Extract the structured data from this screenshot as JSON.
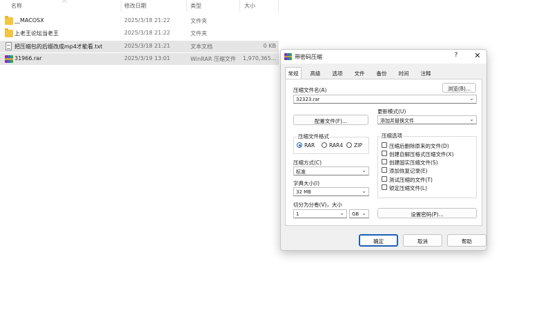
{
  "explorer": {
    "columns": {
      "name": "名称",
      "date": "修改日期",
      "type": "类型",
      "size": "大小"
    },
    "rows": [
      {
        "name": "__MACOSX",
        "date": "2025/3/18 21:22",
        "type": "文件夹",
        "size": "",
        "icon": "folder-icon"
      },
      {
        "name": "上老王论坛当老王",
        "date": "2025/3/18 21:22",
        "type": "文件夹",
        "size": "",
        "icon": "folder-icon"
      },
      {
        "name": "把压缩包的后缀改成mp4才能看.txt",
        "date": "2025/3/18 21:21",
        "type": "文本文档",
        "size": "0 KB",
        "icon": "text-file-icon"
      },
      {
        "name": "31966.rar",
        "date": "2025/3/19 13:01",
        "type": "WinRAR 压缩文件",
        "size": "1,970,365...",
        "icon": "rar-archive-icon"
      }
    ]
  },
  "dialog": {
    "title": "带密码压缩",
    "help": "?",
    "close": "✕",
    "tabs": [
      "常规",
      "高级",
      "选项",
      "文件",
      "备份",
      "时间",
      "注释"
    ],
    "archive_name_label": "压缩文件名(A)",
    "archive_name_value": "32323.rar",
    "browse_label": "浏览(B)...",
    "profiles_label": "配置文件(F)...",
    "update_mode_label": "更新模式(U)",
    "update_mode_value": "添加并替换文件",
    "format_group_label": "压缩文件格式",
    "formats": [
      "RAR",
      "RAR4",
      "ZIP"
    ],
    "selected_format": "RAR",
    "method_label": "压缩方式(C)",
    "method_value": "标准",
    "dict_label": "字典大小(I)",
    "dict_value": "32 MB",
    "split_label": "切分为分卷(V)，大小",
    "split_value": "1",
    "split_unit": "GB",
    "options_group_label": "压缩选项",
    "options": [
      "压缩后删除原来的文件(D)",
      "创建自解压格式压缩文件(X)",
      "创建固实压缩文件(S)",
      "添加恢复记录(E)",
      "测试压缩的文件(T)",
      "锁定压缩文件(L)"
    ],
    "set_password_label": "设置密码(P)...",
    "ok_label": "确定",
    "cancel_label": "取消",
    "help_label": "帮助"
  }
}
